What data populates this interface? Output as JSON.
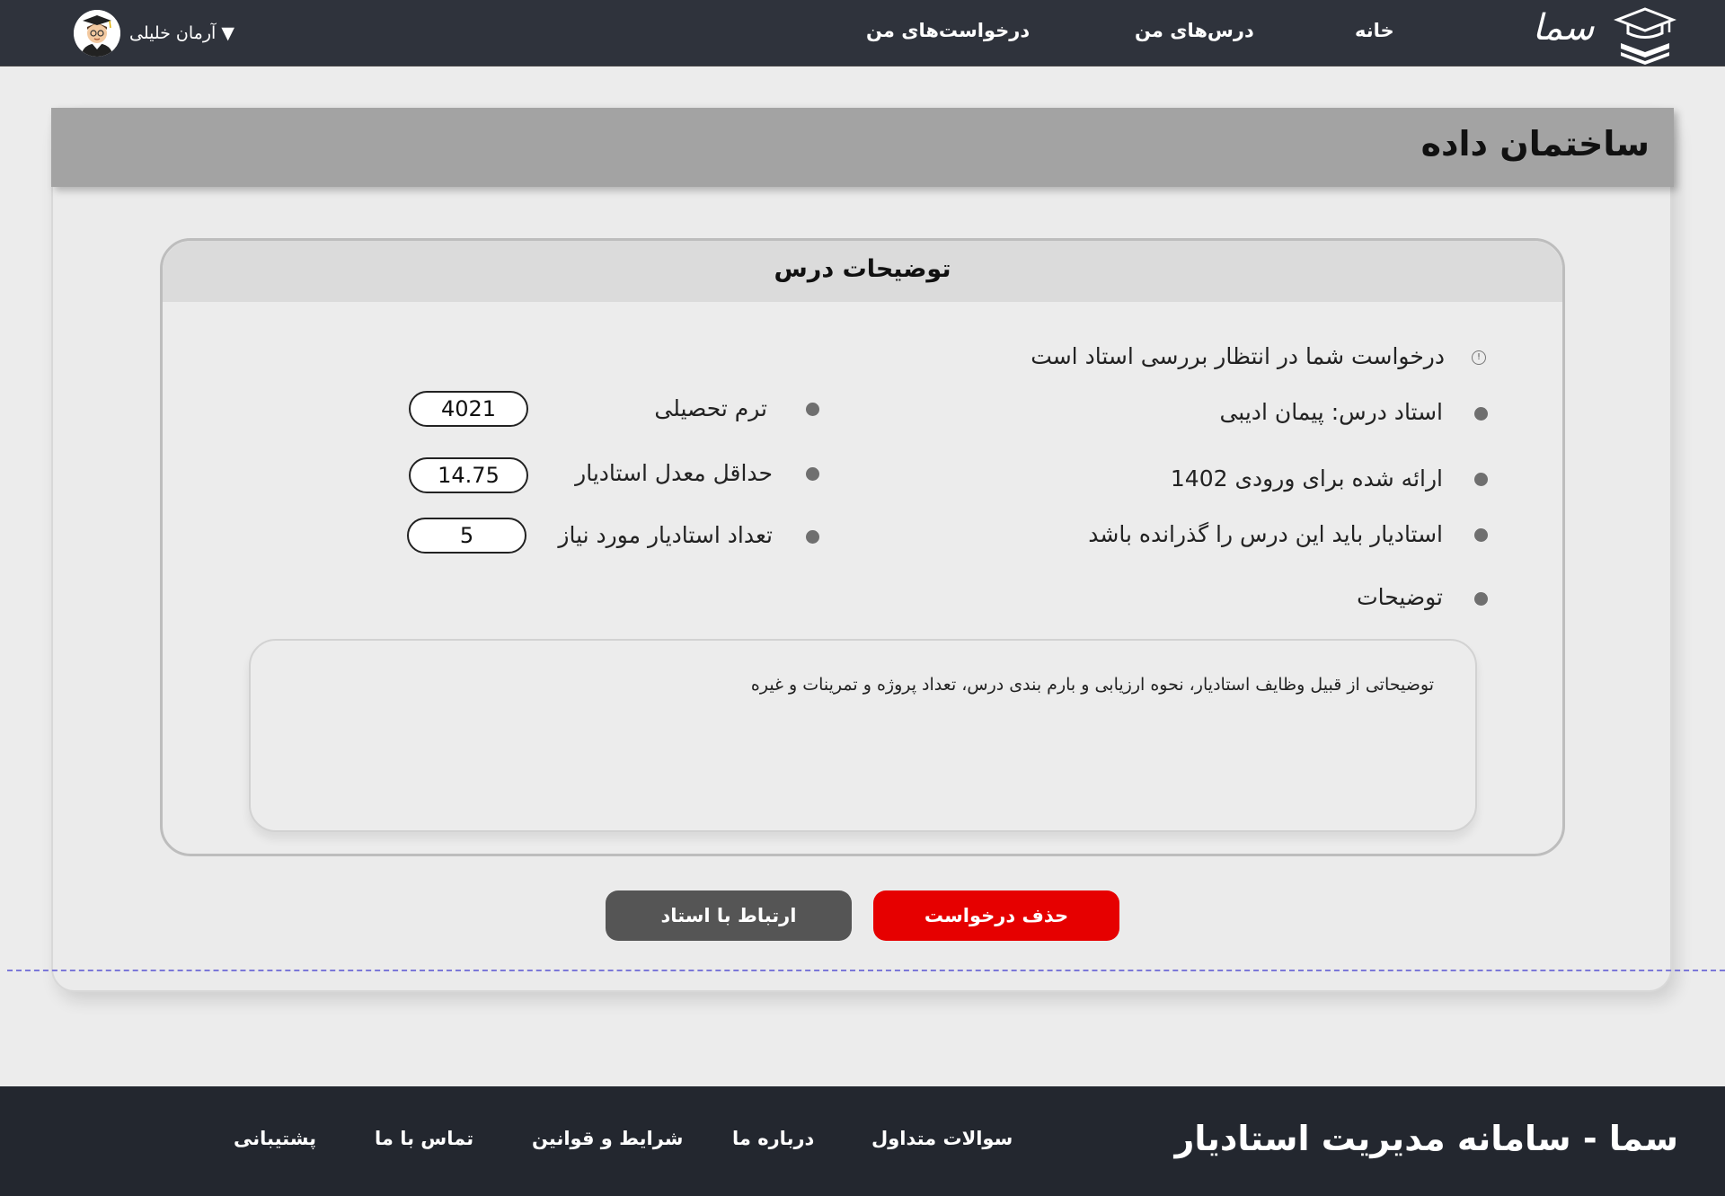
{
  "header": {
    "logo_text": "سما",
    "nav": {
      "home": "خانه",
      "my_courses": "درس‌های من",
      "my_requests": "درخواست‌های من"
    },
    "user": {
      "name": "آرمان خلیلی",
      "dropdown_icon": "▼"
    }
  },
  "page": {
    "title": "ساختمان داده"
  },
  "panel": {
    "title": "توضیحات درس",
    "status_message": "درخواست شما در انتظار بررسی استاد است",
    "status_icon": "!",
    "right_items": {
      "instructor": "استاد درس: پیمان ادیبی",
      "offered_for": "ارائه شده برای  ورودی  1402",
      "prerequisite": "استادیار باید این درس را گذرانده باشد",
      "description_label": "توضیحات"
    },
    "left_items": {
      "term_label": "ترم تحصیلی",
      "term_value": "4021",
      "min_gpa_label": "حداقل معدل استادیار",
      "min_gpa_value": "14.75",
      "ta_count_label": "تعداد استادیار مورد نیاز",
      "ta_count_value": "5"
    },
    "description_text": "توضیحاتی از قبیل وظایف استادیار، نحوه ارزیابی و بارم بندی درس، تعداد پروژه و تمرینات و غیره"
  },
  "actions": {
    "delete_request": "حذف درخواست",
    "contact_instructor": "ارتباط با استاد"
  },
  "footer": {
    "brand": "سما - سامانه مدیریت استادیار",
    "links": {
      "faq": "سوالات متداول",
      "about": "درباره ما",
      "terms": "شرایط و قوانین",
      "contact": "تماس با ما",
      "support": "پشتیبانی"
    }
  },
  "colors": {
    "header_bg": "#2f333c",
    "footer_bg": "#23272f",
    "delete_button": "#e60000",
    "contact_button": "#555555",
    "title_bar": "#a3a3a3"
  },
  "icons": {
    "logo": "graduation-cap-books-icon",
    "avatar": "student-avatar-icon",
    "status": "info-circle-icon"
  }
}
